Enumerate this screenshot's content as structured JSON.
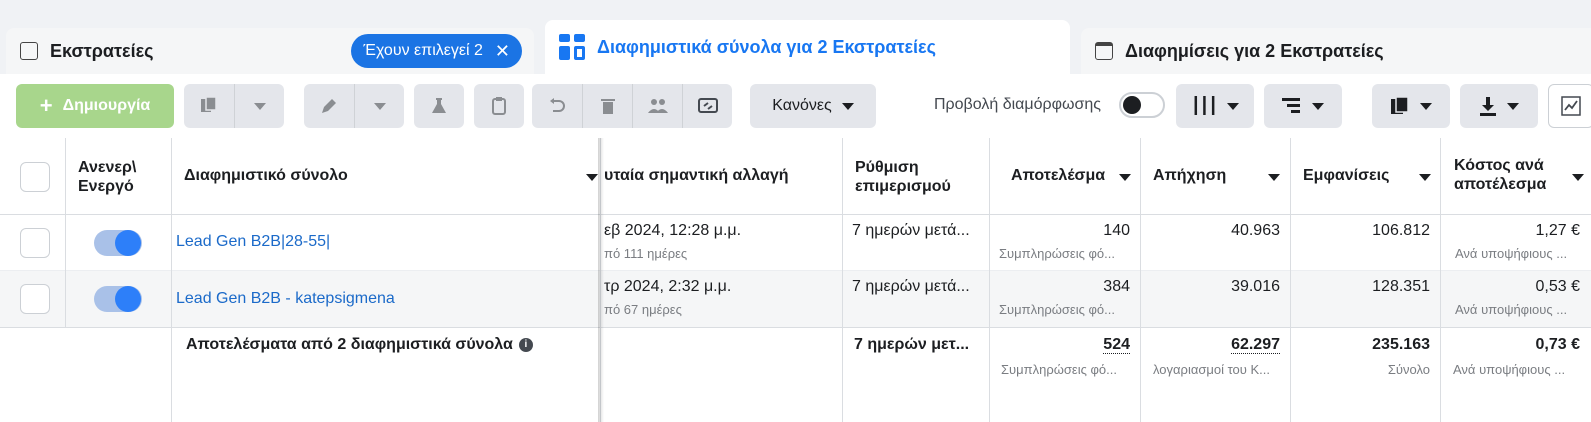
{
  "tabs": {
    "campaigns": {
      "label": "Εκστρατείες",
      "selected_pill": "Έχουν επιλεγεί 2",
      "clear": "✕"
    },
    "adsets": {
      "label": "Διαφημιστικά σύνολα για 2 Εκστρατείες"
    },
    "ads": {
      "label": "Διαφημίσεις για 2 Εκστρατείες"
    }
  },
  "toolbar": {
    "create_label": "Δημιουργία",
    "create_plus": "+",
    "rules_label": "Κανόνες",
    "view_setup_label": "Προβολή διαμόρφωσης"
  },
  "table": {
    "headers": {
      "onoff": "Ανενεργό/\nΕνεργό",
      "onoff_l1": "Ανενερ\\",
      "onoff_l2": "Ενεργό",
      "adset": "Διαφημιστικό σύνολο",
      "last_edit": "υταία σημαντική αλλαγή",
      "attribution_l1": "Ρύθμιση",
      "attribution_l2": "επιμερισμού",
      "results": "Αποτελέσμα",
      "reach": "Απήχηση",
      "impressions": "Εμφανίσεις",
      "cpr_l1": "Κόστος ανά",
      "cpr_l2": "αποτέλεσμα"
    },
    "rows": [
      {
        "name": "Lead Gen B2B|28-55|",
        "last_edit": "εβ 2024, 12:28 μ.μ.",
        "last_edit_sub": "πό 111 ημέρες",
        "attribution": "7 ημερών μετά...",
        "results": "140",
        "results_sub": "Συμπληρώσεις φό...",
        "reach": "40.963",
        "impressions": "106.812",
        "cpr": "1,27 €",
        "cpr_sub": "Ανά υποψήφιους ..."
      },
      {
        "name": "Lead Gen B2B - katepsigmena",
        "last_edit": "τρ 2024, 2:32 μ.μ.",
        "last_edit_sub": "πό 67 ημέρες",
        "attribution": "7 ημερών μετά...",
        "results": "384",
        "results_sub": "Συμπληρώσεις φό...",
        "reach": "39.016",
        "impressions": "128.351",
        "cpr": "0,53 €",
        "cpr_sub": "Ανά υποψήφιους ..."
      }
    ],
    "summary": {
      "label": "Αποτελέσματα από 2 διαφημιστικά σύνολα",
      "info": "i",
      "attribution": "7 ημερών μετ...",
      "results": "524",
      "results_sub": "Συμπληρώσεις φό...",
      "reach": "62.297",
      "reach_sub": "λογαριασμοί του Κ...",
      "impressions": "235.163",
      "impressions_sub": "Σύνολο",
      "cpr": "0,73 €",
      "cpr_sub": "Ανά υποψήφιους ..."
    }
  },
  "colors": {
    "accent": "#1877f2",
    "create_disabled": "#a8d68c",
    "pill": "#1b74e4"
  },
  "icons": [
    "folder-icon",
    "grid-icon",
    "ad-icon",
    "duplicate-icon",
    "pencil-icon",
    "flask-icon",
    "clipboard-icon",
    "undo-icon",
    "trash-icon",
    "audience-icon",
    "preview-icon",
    "columns-icon",
    "breakdown-icon",
    "reports-icon",
    "export-icon",
    "chart-icon",
    "info-icon"
  ]
}
